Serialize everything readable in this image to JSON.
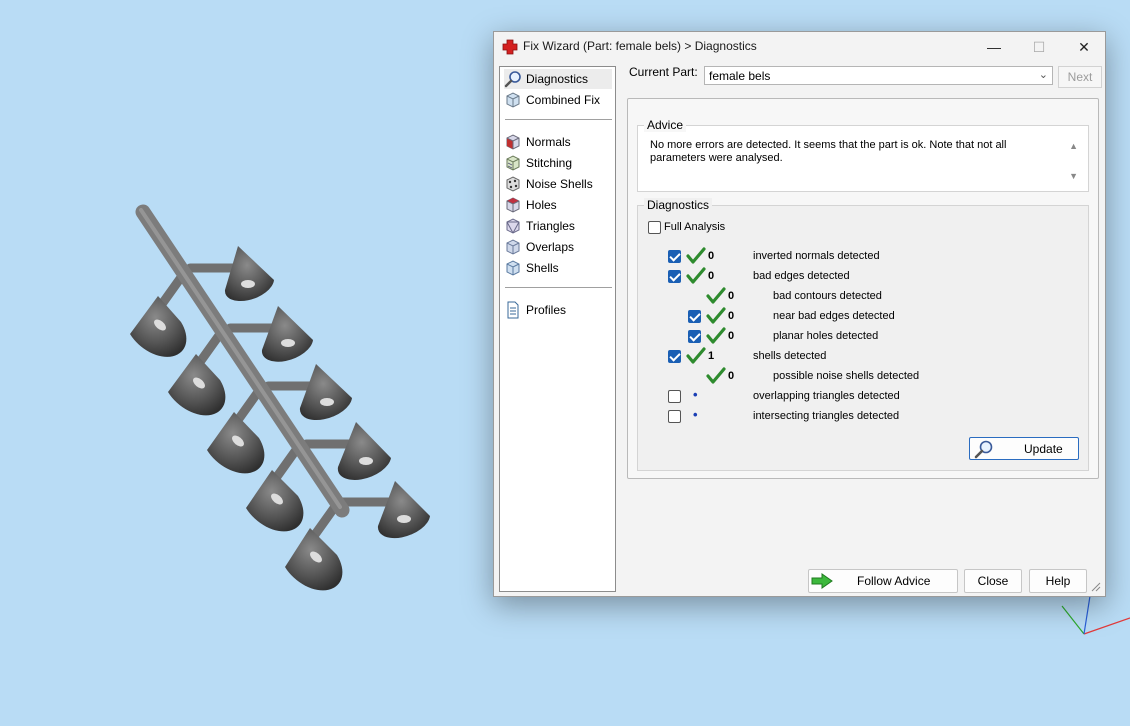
{
  "window": {
    "title": "Fix Wizard (Part: female bels) > Diagnostics",
    "controls": {
      "minimize": "—",
      "maximize": "☐",
      "close": "✕"
    }
  },
  "nav": {
    "items": [
      {
        "label": "Diagnostics",
        "icon": "magnifier-icon"
      },
      {
        "label": "Combined Fix",
        "icon": "cube-icon"
      },
      {
        "label": "Normals",
        "icon": "normals-cube-icon"
      },
      {
        "label": "Stitching",
        "icon": "stitching-cube-icon"
      },
      {
        "label": "Noise Shells",
        "icon": "noise-shells-icon"
      },
      {
        "label": "Holes",
        "icon": "holes-cube-icon"
      },
      {
        "label": "Triangles",
        "icon": "triangles-cube-icon"
      },
      {
        "label": "Overlaps",
        "icon": "overlaps-cube-icon"
      },
      {
        "label": "Shells",
        "icon": "shells-cube-icon"
      },
      {
        "label": "Profiles",
        "icon": "document-icon"
      }
    ]
  },
  "header": {
    "current_part_label": "Current Part:",
    "current_part_value": "female bels",
    "next_label": "Next"
  },
  "advice": {
    "title": "Advice",
    "text": "No more errors are detected. It seems that the part is ok. Note that not all parameters were analysed."
  },
  "diagnostics": {
    "title": "Diagnostics",
    "full_analysis_label": "Full Analysis",
    "full_analysis_checked": false,
    "rows": [
      {
        "checked": true,
        "status": "ok",
        "count": "0",
        "label": "inverted normals detected"
      },
      {
        "checked": true,
        "status": "ok",
        "count": "0",
        "label": "bad edges detected"
      },
      {
        "checked": null,
        "status": "ok",
        "count": "0",
        "label": "bad contours detected"
      },
      {
        "checked": true,
        "status": "ok",
        "count": "0",
        "label": "near bad edges detected"
      },
      {
        "checked": true,
        "status": "ok",
        "count": "0",
        "label": "planar holes detected"
      },
      {
        "checked": true,
        "status": "ok",
        "count": "1",
        "label": "shells detected"
      },
      {
        "checked": null,
        "status": "ok",
        "count": "0",
        "label": "possible noise shells detected"
      },
      {
        "checked": false,
        "status": "unknown",
        "count": "•",
        "label": "overlapping triangles detected"
      },
      {
        "checked": false,
        "status": "unknown",
        "count": "•",
        "label": "intersecting triangles detected"
      }
    ],
    "update_label": "Update"
  },
  "footer": {
    "follow_advice_label": "Follow Advice",
    "close_label": "Close",
    "help_label": "Help"
  },
  "colors": {
    "viewport_bg": "#b9dcf5",
    "checkbox_on": "#1a5fb4",
    "ok_check": "#2e8b2e",
    "part_fill": "#4a4a4a"
  }
}
